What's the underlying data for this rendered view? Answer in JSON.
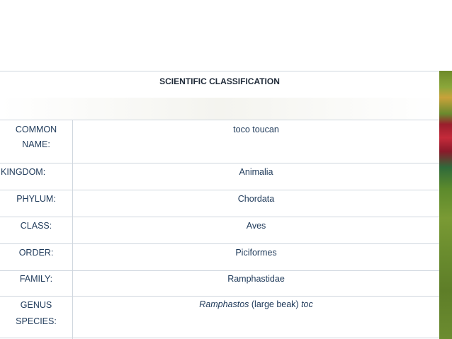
{
  "table": {
    "title": "SCIENTIFIC CLASSIFICATION",
    "rows": [
      {
        "label_line1": "COMMON",
        "label_line2": "NAME:",
        "value": "toco toucan"
      },
      {
        "label": "KINGDOM:",
        "value": "Animalia"
      },
      {
        "label": "PHYLUM:",
        "value": "Chordata"
      },
      {
        "label": "CLASS:",
        "value": "Aves"
      },
      {
        "label": "ORDER:",
        "value": "Piciformes"
      },
      {
        "label": "FAMILY:",
        "value": "Ramphastidae"
      },
      {
        "label_line1": "GENUS",
        "label_line2": "SPECIES:",
        "value_italic_1": "Ramphastos",
        "value_plain": " (large beak) ",
        "value_italic_2": "toc"
      }
    ]
  }
}
